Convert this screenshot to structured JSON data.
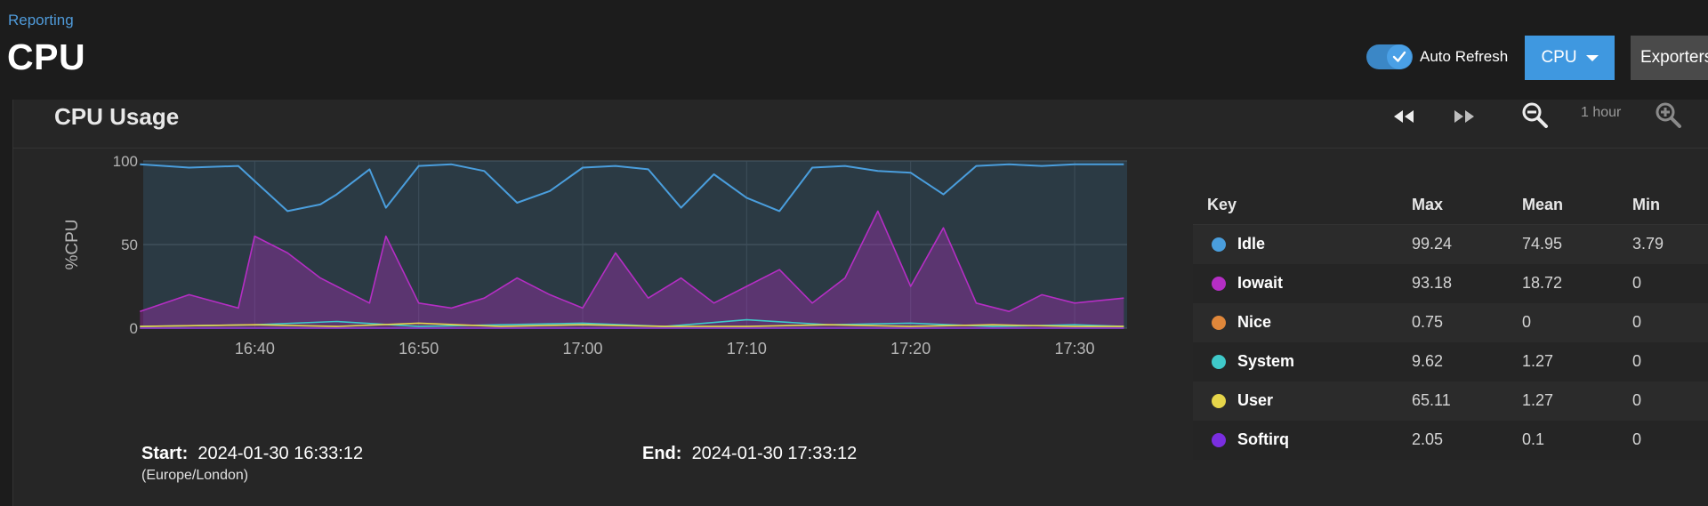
{
  "header": {
    "breadcrumb": "Reporting",
    "title": "CPU",
    "auto_refresh_label": "Auto Refresh",
    "auto_refresh_on": true,
    "cpu_button_label": "CPU",
    "exporters_button_label": "Exporters"
  },
  "panel": {
    "title": "CPU Usage",
    "zoom_label": "1 hour",
    "start_label": "Start:",
    "start_value": "2024-01-30 16:33:12",
    "timezone": "(Europe/London)",
    "end_label": "End:",
    "end_value": "2024-01-30 17:33:12"
  },
  "colors": {
    "accent": "#3f98e0",
    "idle": "#4a9edd",
    "iowait": "#b52ec4",
    "nice": "#e0873a",
    "system": "#3fc9c9",
    "user": "#e6d54a",
    "softirq": "#7a2ee0"
  },
  "chart_data": {
    "type": "line",
    "ylabel": "%CPU",
    "ylim": [
      0,
      100
    ],
    "yticks": [
      "0",
      "50",
      "100"
    ],
    "xticks": [
      "16:40",
      "16:50",
      "17:00",
      "17:10",
      "17:20",
      "17:30"
    ],
    "x_range": [
      "16:33:12",
      "17:33:12"
    ],
    "series": [
      {
        "name": "Idle",
        "color": "#4a9edd",
        "x": [
          "16:33",
          "16:36",
          "16:39",
          "16:40",
          "16:42",
          "16:44",
          "16:45",
          "16:47",
          "16:48",
          "16:50",
          "16:52",
          "16:54",
          "16:56",
          "16:58",
          "17:00",
          "17:02",
          "17:04",
          "17:06",
          "17:08",
          "17:10",
          "17:12",
          "17:14",
          "17:16",
          "17:18",
          "17:20",
          "17:22",
          "17:24",
          "17:26",
          "17:28",
          "17:30",
          "17:33"
        ],
        "values": [
          98,
          96,
          97,
          88,
          70,
          74,
          80,
          95,
          72,
          97,
          98,
          94,
          75,
          82,
          96,
          97,
          95,
          72,
          92,
          78,
          70,
          96,
          97,
          94,
          93,
          80,
          97,
          98,
          97,
          98,
          98
        ]
      },
      {
        "name": "Iowait",
        "color": "#b52ec4",
        "x": [
          "16:33",
          "16:36",
          "16:39",
          "16:40",
          "16:42",
          "16:44",
          "16:45",
          "16:47",
          "16:48",
          "16:50",
          "16:52",
          "16:54",
          "16:56",
          "16:58",
          "17:00",
          "17:02",
          "17:04",
          "17:06",
          "17:08",
          "17:10",
          "17:12",
          "17:14",
          "17:16",
          "17:18",
          "17:20",
          "17:22",
          "17:24",
          "17:26",
          "17:28",
          "17:30",
          "17:33"
        ],
        "values": [
          10,
          20,
          12,
          55,
          45,
          30,
          25,
          15,
          55,
          15,
          12,
          18,
          30,
          20,
          12,
          45,
          18,
          30,
          15,
          25,
          35,
          15,
          30,
          70,
          25,
          60,
          15,
          10,
          20,
          15,
          18
        ]
      },
      {
        "name": "Nice",
        "color": "#e0873a",
        "x": [
          "16:33",
          "17:33"
        ],
        "values": [
          0,
          0
        ]
      },
      {
        "name": "System",
        "color": "#3fc9c9",
        "x": [
          "16:33",
          "16:40",
          "16:45",
          "16:50",
          "16:55",
          "17:00",
          "17:05",
          "17:10",
          "17:15",
          "17:20",
          "17:25",
          "17:30",
          "17:33"
        ],
        "values": [
          1,
          2,
          4,
          1,
          2,
          3,
          1,
          5,
          2,
          3,
          1,
          2,
          1
        ]
      },
      {
        "name": "User",
        "color": "#e6d54a",
        "x": [
          "16:33",
          "16:40",
          "16:45",
          "16:50",
          "16:55",
          "17:00",
          "17:05",
          "17:10",
          "17:15",
          "17:20",
          "17:25",
          "17:30",
          "17:33"
        ],
        "values": [
          1,
          2,
          1,
          3,
          1,
          2,
          1,
          1,
          2,
          1,
          2,
          1,
          1
        ]
      },
      {
        "name": "Softirq",
        "color": "#7a2ee0",
        "x": [
          "16:33",
          "17:33"
        ],
        "values": [
          0,
          0
        ]
      }
    ]
  },
  "legend": {
    "headers": {
      "key": "Key",
      "max": "Max",
      "mean": "Mean",
      "min": "Min"
    },
    "rows": [
      {
        "name": "Idle",
        "color": "#4a9edd",
        "max": "99.24",
        "mean": "74.95",
        "min": "3.79"
      },
      {
        "name": "Iowait",
        "color": "#b52ec4",
        "max": "93.18",
        "mean": "18.72",
        "min": "0"
      },
      {
        "name": "Nice",
        "color": "#e0873a",
        "max": "0.75",
        "mean": "0",
        "min": "0"
      },
      {
        "name": "System",
        "color": "#3fc9c9",
        "max": "9.62",
        "mean": "1.27",
        "min": "0"
      },
      {
        "name": "User",
        "color": "#e6d54a",
        "max": "65.11",
        "mean": "1.27",
        "min": "0"
      },
      {
        "name": "Softirq",
        "color": "#7a2ee0",
        "max": "2.05",
        "mean": "0.1",
        "min": "0"
      }
    ]
  }
}
